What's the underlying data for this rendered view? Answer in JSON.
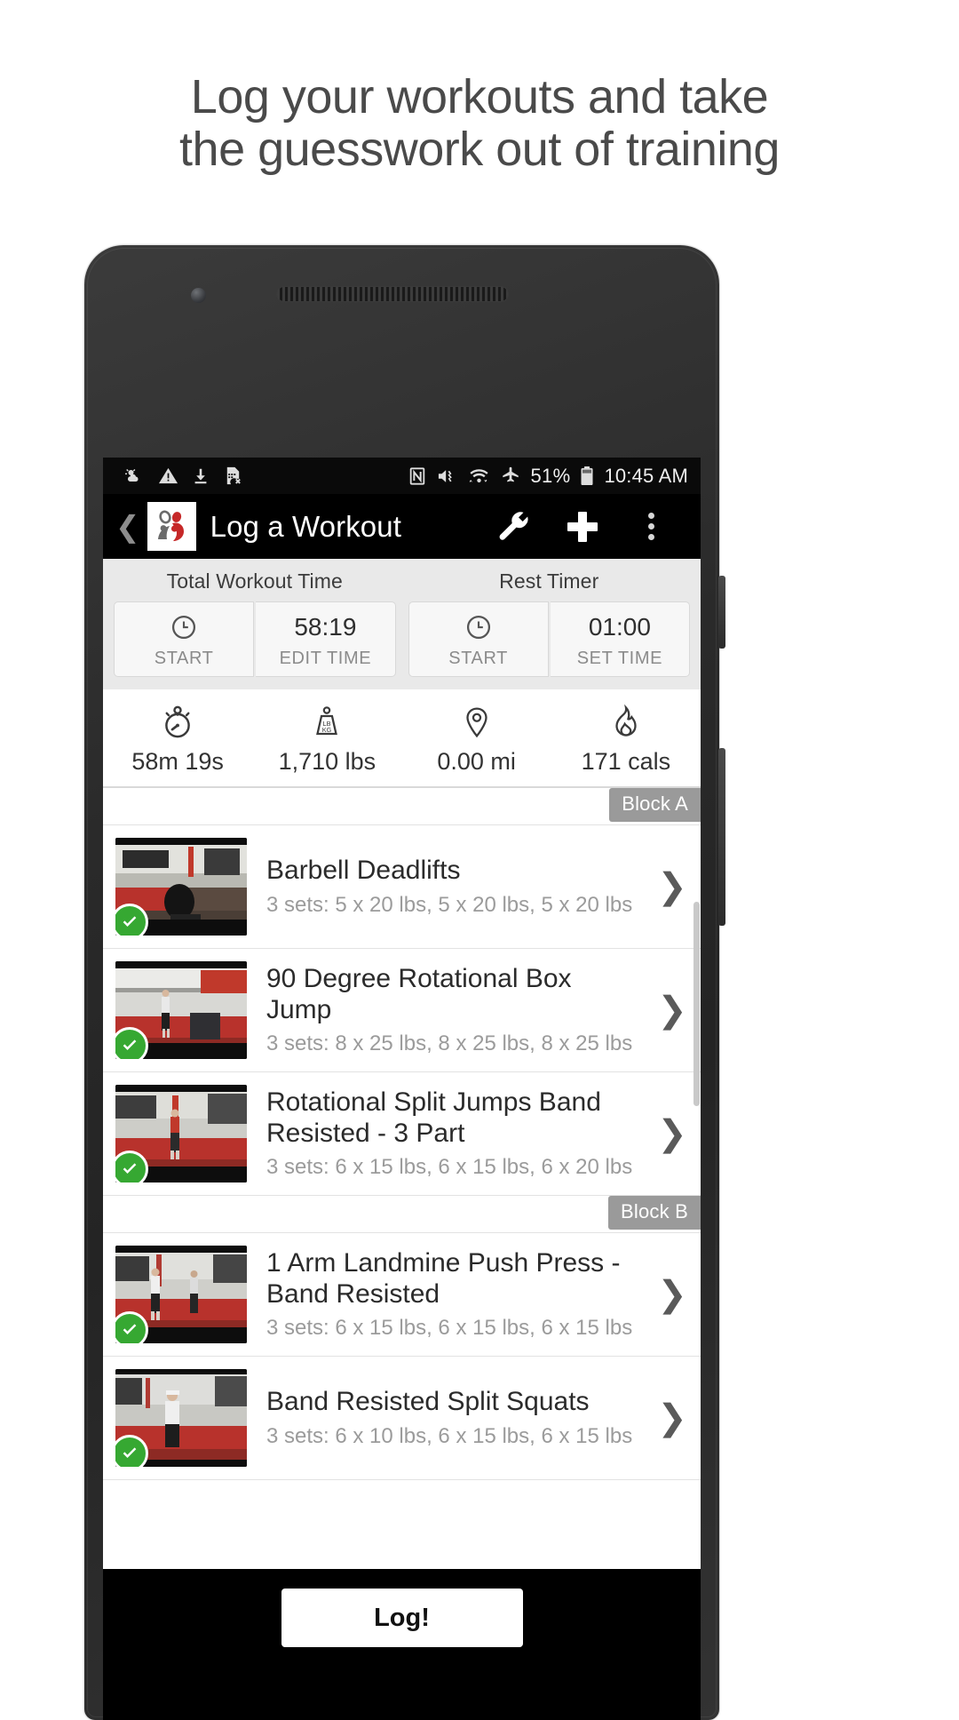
{
  "promo": {
    "line1": "Log your workouts and take",
    "line2": "the guesswork out of training"
  },
  "statusbar": {
    "icons_left": [
      "weather-partly-sunny-icon",
      "warning-triangle-icon",
      "download-icon",
      "sim-card-error-icon"
    ],
    "icons_right": [
      "nfc-icon",
      "mute-vibrate-icon",
      "wifi-icon",
      "airplane-mode-icon"
    ],
    "battery_percent": "51%",
    "battery_icon": "battery-icon",
    "time": "10:45 AM"
  },
  "appbar": {
    "back_icon": "back-chevron-icon",
    "logo_icon": "app-logo-icon",
    "title": "Log a Workout",
    "wrench_icon": "wrench-icon",
    "plus_icon": "plus-icon",
    "overflow_icon": "overflow-menu-icon"
  },
  "timers": [
    {
      "label": "Total Workout Time",
      "start_label": "START",
      "start_icon": "clock-icon",
      "value": "58:19",
      "value_sub": "EDIT TIME"
    },
    {
      "label": "Rest Timer",
      "start_label": "START",
      "start_icon": "clock-icon",
      "value": "01:00",
      "value_sub": "SET TIME"
    }
  ],
  "stats": [
    {
      "icon": "stopwatch-icon",
      "value": "58m 19s"
    },
    {
      "icon": "weight-plate-icon",
      "value": "1,710 lbs"
    },
    {
      "icon": "map-pin-icon",
      "value": "0.00 mi"
    },
    {
      "icon": "flame-icon",
      "value": "171 cals"
    }
  ],
  "blocks": [
    {
      "badge": "Block A",
      "exercises": [
        {
          "name": "Barbell Deadlifts",
          "sets": "3 sets: 5 x 20 lbs, 5 x 20 lbs, 5 x 20 lbs",
          "completed": true,
          "chevron": "chevron-right-icon",
          "thumb": "barbell-deadlifts-thumbnail"
        },
        {
          "name": "90 Degree Rotational Box Jump",
          "sets": "3 sets: 8 x 25 lbs, 8 x 25 lbs, 8 x 25 lbs",
          "completed": true,
          "chevron": "chevron-right-icon",
          "thumb": "box-jump-thumbnail"
        },
        {
          "name": "Rotational Split Jumps Band Resisted - 3 Part",
          "sets": "3 sets: 6 x 15 lbs, 6 x 15 lbs, 6 x 20 lbs",
          "completed": true,
          "chevron": "chevron-right-icon",
          "thumb": "split-jumps-thumbnail"
        }
      ]
    },
    {
      "badge": "Block B",
      "exercises": [
        {
          "name": "1 Arm Landmine Push Press - Band Resisted",
          "sets": "3 sets: 6 x 15 lbs, 6 x 15 lbs, 6 x 15 lbs",
          "completed": true,
          "chevron": "chevron-right-icon",
          "thumb": "landmine-push-press-thumbnail"
        },
        {
          "name": "Band Resisted Split Squats",
          "sets": "3 sets: 6 x 10 lbs, 6 x 15 lbs, 6 x 15 lbs",
          "completed": true,
          "chevron": "chevron-right-icon",
          "thumb": "split-squats-thumbnail"
        }
      ]
    }
  ],
  "bottombar": {
    "log_label": "Log!"
  }
}
